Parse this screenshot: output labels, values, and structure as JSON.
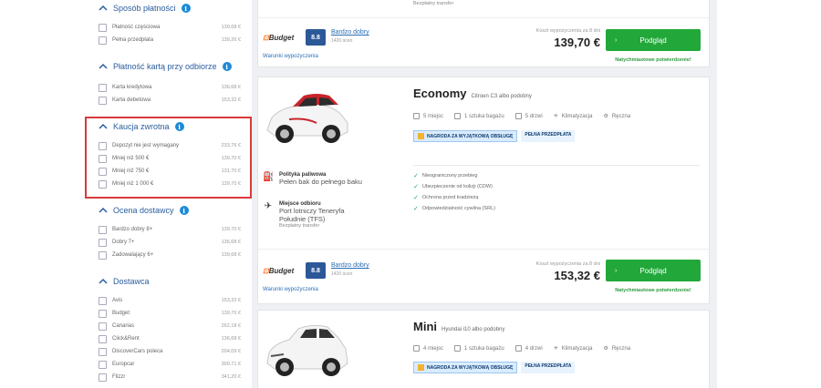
{
  "sidebar": {
    "payment_method": {
      "title": "Sposób płatności",
      "options": [
        {
          "label": "Płatność częściowa",
          "price": "139,68 €"
        },
        {
          "label": "Pełna przedpłata",
          "price": "139,26 €"
        }
      ]
    },
    "card_payment": {
      "title": "Płatność kartą przy odbiorze",
      "options": [
        {
          "label": "Karta kredytowa",
          "price": "136,68 €"
        },
        {
          "label": "Karta debetowa",
          "price": "153,32 €"
        }
      ]
    },
    "deposit": {
      "title": "Kaucja zwrotna",
      "options": [
        {
          "label": "Depozyt nie jest wymagany",
          "price": "233,76 €"
        },
        {
          "label": "Mniej niż 500 €",
          "price": "139,70 €"
        },
        {
          "label": "Mniej niż 750 €",
          "price": "131,70 €"
        },
        {
          "label": "Mniej niż 1 000 €",
          "price": "139,70 €"
        }
      ]
    },
    "supplier_rating": {
      "title": "Ocena dostawcy",
      "options": [
        {
          "label": "Bardzo dobry 8+",
          "price": "139,70 €"
        },
        {
          "label": "Dobry 7+",
          "price": "136,68 €"
        },
        {
          "label": "Zadowalający 6+",
          "price": "139,68 €"
        }
      ]
    },
    "supplier": {
      "title": "Dostawca",
      "options": [
        {
          "label": "Avis",
          "price": "153,32 €"
        },
        {
          "label": "Budget",
          "price": "139,70 €"
        },
        {
          "label": "Canarias",
          "price": "262,18 €"
        },
        {
          "label": "Click&Rent",
          "price": "136,68 €"
        },
        {
          "label": "DiscoverCars poleca",
          "price": "204,09 €"
        },
        {
          "label": "Europcar",
          "price": "300,71 €"
        },
        {
          "label": "Flizzr",
          "price": "341,20 €"
        }
      ]
    }
  },
  "card0": {
    "transfer_note": "Bezpłatny transfer",
    "supplier_logo": "Budget",
    "score": "8.8",
    "score_label": "Bardzo dobry",
    "score_count": "1420 ocen",
    "cancel_link": "Warunki wypożyczenia",
    "price_caption": "Koszt wypożyczenia za 8 dni",
    "price": "139,70 €",
    "button": "Podgląd",
    "confirm": "Natychmiastowe potwierdzenie!"
  },
  "card1": {
    "title": "Economy",
    "subtitle": "Citroen C3 albo podobny",
    "features": [
      "5 miejsc",
      "1 sztuka bagażu",
      "5 drzwi",
      "Klimatyzacja",
      "Ręczna"
    ],
    "badge_award": "NAGRODA ZA WYJĄTKOWĄ OBSŁUGĘ",
    "badge_full": "PEŁNA PRZEDPŁATA",
    "fuel_title": "Polityka paliwowa",
    "fuel_value": "Pełen bak do pełnego baku",
    "pickup_title": "Miejsce odbioru",
    "pickup_value_1": "Port lotniczy Teneryfa",
    "pickup_value_2": "Południe (TFS)",
    "pickup_note": "Bezpłatny transfer",
    "checks": [
      "Nieograniczony przebieg",
      "Ubezpieczenie od kolizji (CDW)",
      "Ochrona przed kradzieżą",
      "Odpowiedzialność cywilna (SRL)"
    ],
    "supplier_logo": "Budget",
    "score": "8.8",
    "score_label": "Bardzo dobry",
    "score_count": "1420 ocen",
    "cancel_link": "Warunki wypożyczenia",
    "price_caption": "Koszt wypożyczenia za 8 dni",
    "price": "153,32 €",
    "button": "Podgląd",
    "confirm": "Natychmiastowe potwierdzenie!"
  },
  "card2": {
    "title": "Mini",
    "subtitle": "Hyundai i10 albo podobny",
    "features": [
      "4 miejsc",
      "1 sztuka bagażu",
      "4 drzwi",
      "Klimatyzacja",
      "Ręczna"
    ],
    "badge_award": "NAGRODA ZA WYJĄTKOWĄ OBSŁUGĘ",
    "badge_full": "PEŁNA PRZEDPŁATA"
  },
  "colors": {
    "accent_blue": "#2a5d9e",
    "button_green": "#22a83a",
    "highlight_red": "#d9393b"
  }
}
